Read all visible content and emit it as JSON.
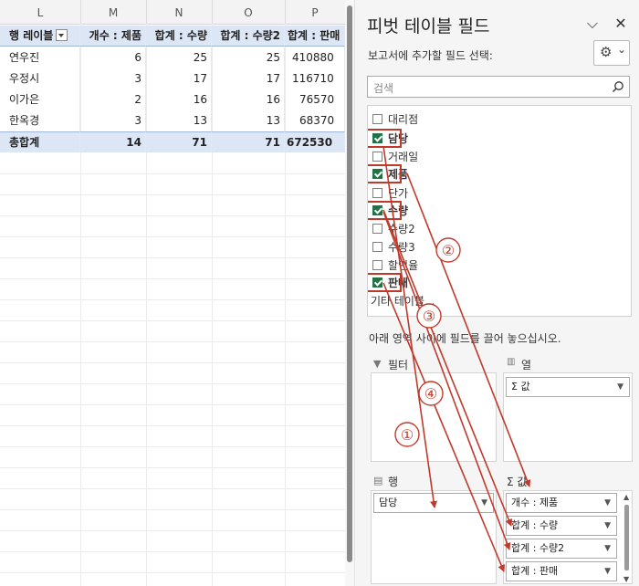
{
  "sheet": {
    "columns": [
      "L",
      "M",
      "N",
      "O",
      "P"
    ],
    "header_row": [
      "행 레이블",
      "개수 : 제품",
      "합계 : 수량",
      "합계 : 수량2",
      "합계 : 판매"
    ],
    "rows": [
      [
        "연우진",
        "6",
        "25",
        "25",
        "410880"
      ],
      [
        "우정시",
        "3",
        "17",
        "17",
        "116710"
      ],
      [
        "이가은",
        "2",
        "16",
        "16",
        "76570"
      ],
      [
        "한옥경",
        "3",
        "13",
        "13",
        "68370"
      ]
    ],
    "total_row": [
      "총합계",
      "14",
      "71",
      "71",
      "672530"
    ]
  },
  "pane": {
    "title": "피벗 테이블 필드",
    "collapse_glyph": "⌵",
    "close_glyph": "✕",
    "subtitle": "보고서에 추가할 필드 선택:",
    "gear_icon": "⚙",
    "gear_chevron": "⌄",
    "search_placeholder": "검색",
    "fields": [
      {
        "label": "대리점",
        "checked": false
      },
      {
        "label": "담당",
        "checked": true
      },
      {
        "label": "거래일",
        "checked": false
      },
      {
        "label": "제품",
        "checked": true
      },
      {
        "label": "단가",
        "checked": false
      },
      {
        "label": "수량",
        "checked": true
      },
      {
        "label": "수량2",
        "checked": false
      },
      {
        "label": "수량3",
        "checked": false
      },
      {
        "label": "할인율",
        "checked": false
      },
      {
        "label": "판매",
        "checked": true
      }
    ],
    "more_tables": "기타 테이블...",
    "drag_hint": "아래 영역 사이에 필드를 끌어 놓으십시오.",
    "areas": {
      "filter": {
        "label": "필터"
      },
      "columns": {
        "label": "열",
        "items": [
          "Σ 값"
        ]
      },
      "rows": {
        "label": "행",
        "items": [
          "담당"
        ]
      },
      "values": {
        "label": "Σ 값",
        "items": [
          "개수 : 제품",
          "합계 : 수량",
          "합계 : 수량2",
          "합계 : 판매"
        ]
      }
    }
  },
  "annotations": {
    "labels": [
      "①",
      "②",
      "③",
      "④"
    ],
    "color": "#c0392b"
  }
}
